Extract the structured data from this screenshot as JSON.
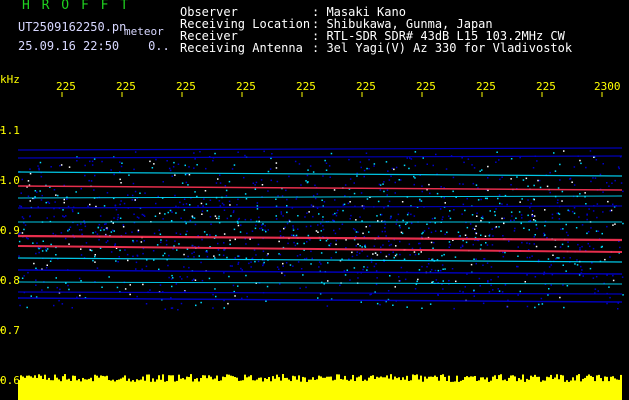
{
  "header": {
    "app_title": "H R O F F T",
    "filename": "UT2509162250.pn",
    "filename_suffix": "meteor",
    "datetime": "25.09.16 22:50",
    "datetime_extra": "0..",
    "fields": [
      {
        "label": "Observer",
        "value": ": Masaki Kano"
      },
      {
        "label": "Receiving Location",
        "value": ": Shibukawa, Gunma, Japan"
      },
      {
        "label": "Receiver",
        "value": ": RTL-SDR SDR# 43dB L15 103.2MHz CW"
      },
      {
        "label": "Receiving Antenna",
        "value": ": 3el Yagi(V) Az 330 for Vladivostok"
      }
    ]
  },
  "axis": {
    "unit": "kHz",
    "x_ticks": [
      "225",
      "225",
      "225",
      "225",
      "225",
      "225",
      "225",
      "225",
      "225",
      "2300"
    ],
    "y_ticks": [
      "1.1",
      "1.0",
      "0.9",
      "0.8",
      "0.7",
      "0.6"
    ]
  },
  "colors": {
    "background": "#000000",
    "axis_text": "#ffff00",
    "signal_low": "#0000cc",
    "signal_mid": "#00ddff",
    "signal_high": "#ff3355",
    "power_bar": "#ffff00"
  }
}
